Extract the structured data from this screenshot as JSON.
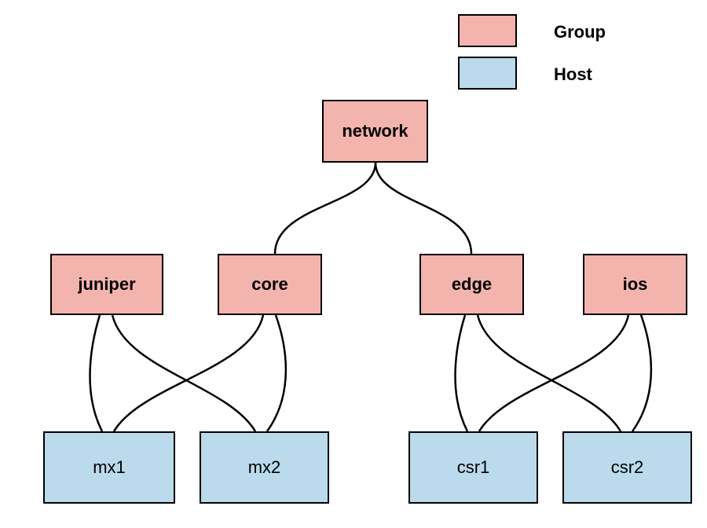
{
  "legend": {
    "group_label": "Group",
    "host_label": "Host",
    "group_color": "#f4b4ae",
    "host_color": "#bbdaeb"
  },
  "nodes": {
    "root": {
      "label": "network",
      "type": "group"
    },
    "tier2": [
      {
        "id": "juniper",
        "label": "juniper",
        "type": "group"
      },
      {
        "id": "core",
        "label": "core",
        "type": "group"
      },
      {
        "id": "edge",
        "label": "edge",
        "type": "group"
      },
      {
        "id": "ios",
        "label": "ios",
        "type": "group"
      }
    ],
    "tier3": [
      {
        "id": "mx1",
        "label": "mx1",
        "type": "host"
      },
      {
        "id": "mx2",
        "label": "mx2",
        "type": "host"
      },
      {
        "id": "csr1",
        "label": "csr1",
        "type": "host"
      },
      {
        "id": "csr2",
        "label": "csr2",
        "type": "host"
      }
    ]
  },
  "edges": [
    {
      "from": "network",
      "to": "core"
    },
    {
      "from": "network",
      "to": "edge"
    },
    {
      "from": "juniper",
      "to": "mx1"
    },
    {
      "from": "juniper",
      "to": "mx2"
    },
    {
      "from": "core",
      "to": "mx1"
    },
    {
      "from": "core",
      "to": "mx2"
    },
    {
      "from": "edge",
      "to": "csr1"
    },
    {
      "from": "edge",
      "to": "csr2"
    },
    {
      "from": "ios",
      "to": "csr1"
    },
    {
      "from": "ios",
      "to": "csr2"
    }
  ]
}
